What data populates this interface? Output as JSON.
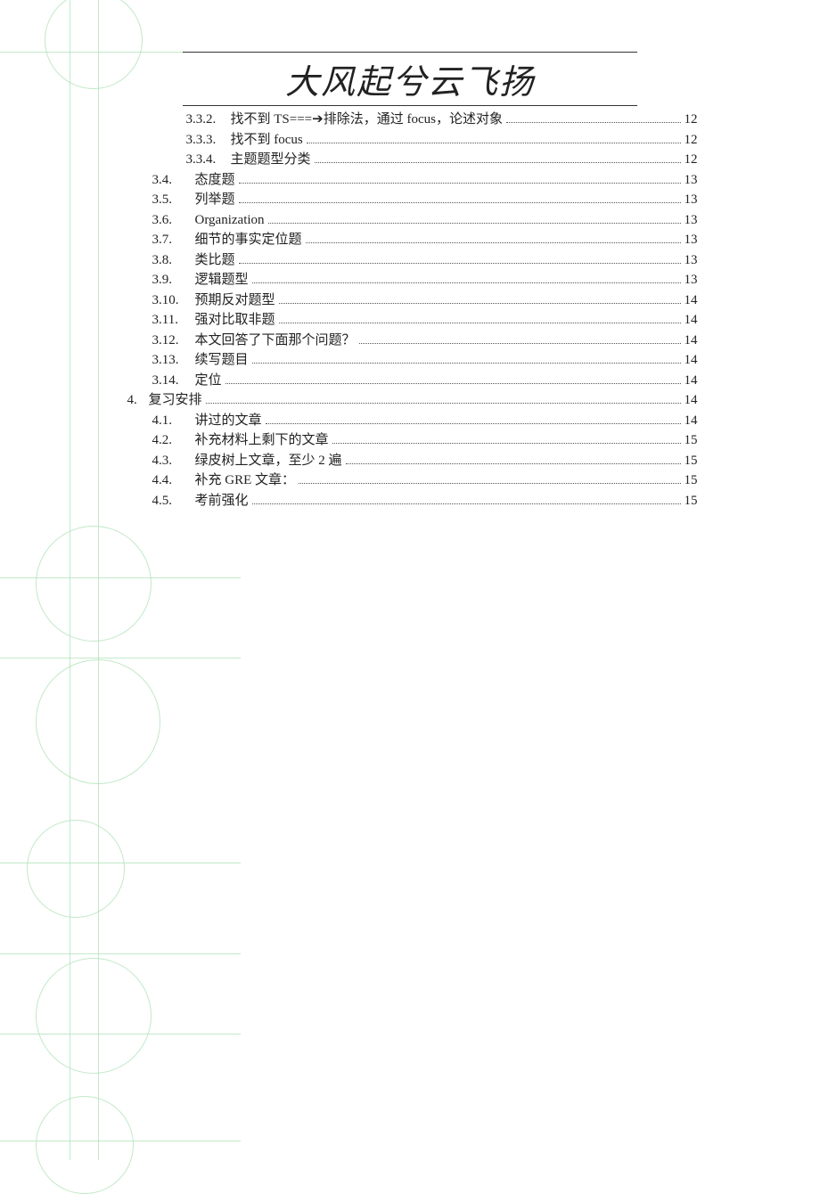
{
  "title": "大风起兮云飞扬",
  "toc": [
    {
      "level": 3,
      "num": "3.3.2.",
      "text": "找不到 TS===➔排除法，通过 focus，论述对象",
      "page": "12"
    },
    {
      "level": 3,
      "num": "3.3.3.",
      "text": "找不到 focus",
      "page": "12"
    },
    {
      "level": 3,
      "num": "3.3.4.",
      "text": "主题题型分类",
      "page": "12"
    },
    {
      "level": 2,
      "num": "3.4.",
      "text": "态度题",
      "page": "13"
    },
    {
      "level": 2,
      "num": "3.5.",
      "text": "列举题",
      "page": "13"
    },
    {
      "level": 2,
      "num": "3.6.",
      "text": "Organization",
      "page": "13"
    },
    {
      "level": 2,
      "num": "3.7.",
      "text": "细节的事实定位题",
      "page": "13"
    },
    {
      "level": 2,
      "num": "3.8.",
      "text": "类比题",
      "page": "13"
    },
    {
      "level": 2,
      "num": "3.9.",
      "text": "逻辑题型",
      "page": "13"
    },
    {
      "level": 2,
      "num": "3.10.",
      "text": "预期反对题型",
      "page": "14"
    },
    {
      "level": 2,
      "num": "3.11.",
      "text": "强对比取非题",
      "page": "14"
    },
    {
      "level": 2,
      "num": "3.12.",
      "text": "本文回答了下面那个问题？",
      "page": "14"
    },
    {
      "level": 2,
      "num": "3.13.",
      "text": "续写题目",
      "page": "14"
    },
    {
      "level": 2,
      "num": "3.14.",
      "text": "定位",
      "page": "14"
    },
    {
      "level": 1,
      "num": "4.",
      "text": "复习安排",
      "page": "14"
    },
    {
      "level": 2,
      "num": "4.1.",
      "text": "讲过的文章",
      "page": "14"
    },
    {
      "level": 2,
      "num": "4.2.",
      "text": "补充材料上剩下的文章",
      "page": "15"
    },
    {
      "level": 2,
      "num": "4.3.",
      "text": "绿皮树上文章，至少 2 遍",
      "page": "15"
    },
    {
      "level": 2,
      "num": "4.4.",
      "text": "补充 GRE 文章：",
      "page": "15"
    },
    {
      "level": 2,
      "num": "4.5.",
      "text": "考前强化",
      "page": "15"
    }
  ]
}
